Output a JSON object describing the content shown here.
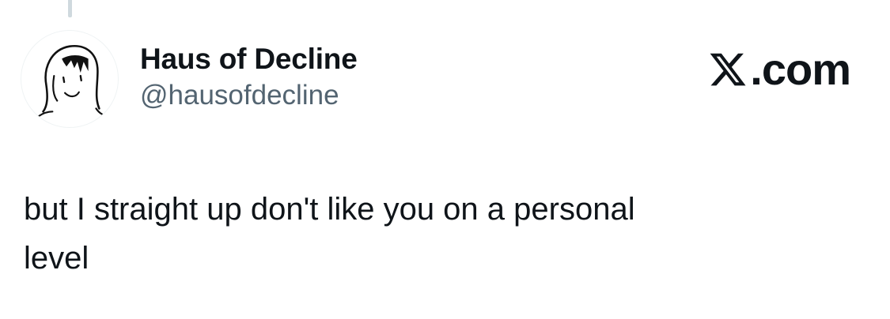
{
  "tweet": {
    "author": {
      "display_name": "Haus of Decline",
      "handle": "@hausofdecline",
      "avatar_icon": "hand-drawn-face-avatar"
    },
    "brand": {
      "logo_icon": "x-logo-icon",
      "suffix": ".com"
    },
    "text": "but I straight up don't like you on a personal\nlevel"
  },
  "colors": {
    "text_primary": "#0f1419",
    "text_secondary": "#536471",
    "thread_line": "#cfd9de",
    "background": "#ffffff"
  }
}
